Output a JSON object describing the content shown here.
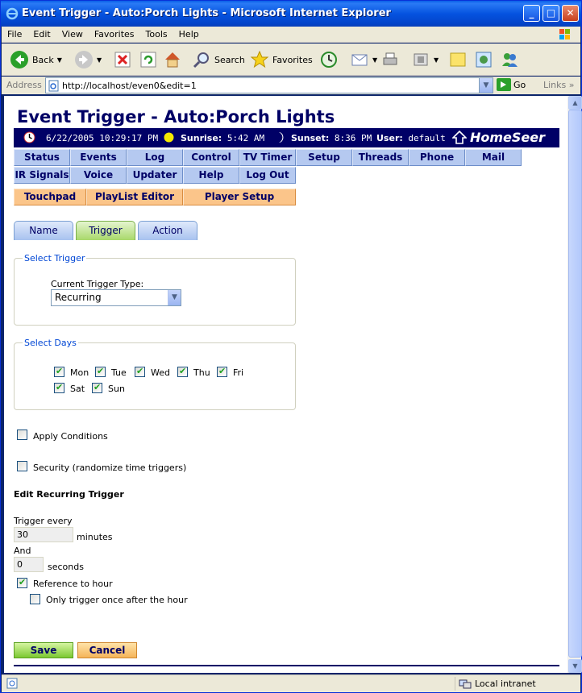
{
  "window": {
    "title": "Event Trigger - Auto:Porch Lights - Microsoft Internet Explorer"
  },
  "menu": [
    "File",
    "Edit",
    "View",
    "Favorites",
    "Tools",
    "Help"
  ],
  "toolbar": {
    "back": "Back",
    "search": "Search",
    "favorites": "Favorites"
  },
  "address": {
    "label": "Address",
    "url": "http://localhost/even0&edit=1",
    "go": "Go",
    "links": "Links"
  },
  "page": {
    "title": "Event Trigger - Auto:Porch Lights",
    "info": {
      "datetime": "6/22/2005 10:29:17 PM",
      "sunrise_label": "Sunrise:",
      "sunrise": "5:42 AM",
      "sunset_label": "Sunset:",
      "sunset": "8:36 PM",
      "user_label": "User:",
      "user": "default",
      "brand": "HomeSeer"
    },
    "nav_row1": [
      "Status",
      "Events",
      "Log",
      "Control",
      "TV Timer",
      "Setup",
      "Threads",
      "Phone",
      "Mail"
    ],
    "nav_row2": [
      "IR Signals",
      "Voice",
      "Updater",
      "Help",
      "Log Out"
    ],
    "nav_row3": [
      "Touchpad",
      "PlayList Editor",
      "Player Setup"
    ],
    "tabs": [
      "Name",
      "Trigger",
      "Action"
    ],
    "select_trigger": {
      "legend": "Select Trigger",
      "label": "Current Trigger Type:",
      "value": "Recurring"
    },
    "select_days": {
      "legend": "Select Days",
      "days": [
        "Mon",
        "Tue",
        "Wed",
        "Thu",
        "Fri",
        "Sat",
        "Sun"
      ]
    },
    "apply_conditions": "Apply Conditions",
    "security": "Security (randomize time triggers)",
    "edit_heading": "Edit Recurring Trigger",
    "trigger_every_label": "Trigger every",
    "minutes_value": "30",
    "minutes_unit": "minutes",
    "and_label": "And",
    "seconds_value": "0",
    "seconds_unit": "seconds",
    "reference_hour": "Reference to hour",
    "only_once": "Only trigger once after the hour",
    "save": "Save",
    "cancel": "Cancel"
  },
  "status": {
    "zone": "Local intranet"
  }
}
